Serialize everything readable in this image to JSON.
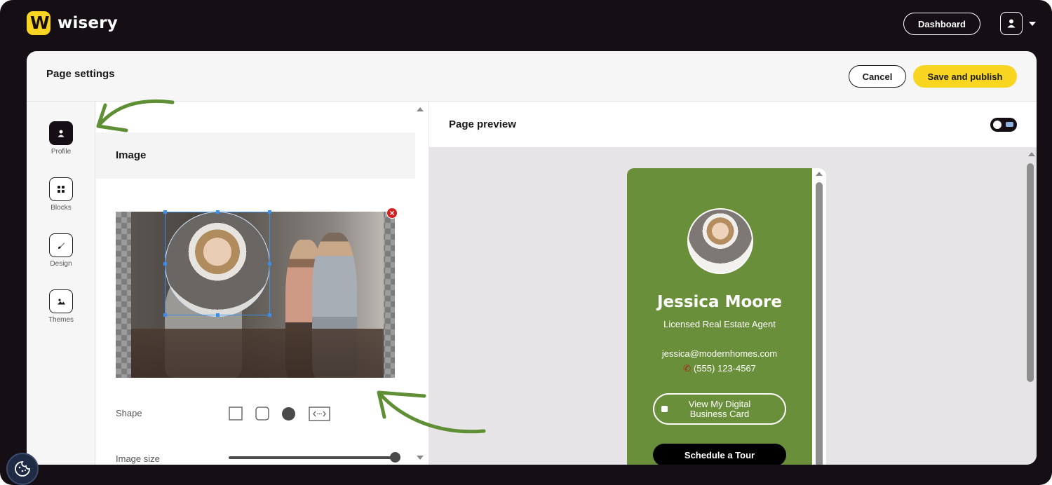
{
  "app": {
    "brand": "wisery",
    "logo_letter": "W"
  },
  "topbar": {
    "dashboard_label": "Dashboard"
  },
  "header": {
    "title": "Page settings",
    "cancel_label": "Cancel",
    "publish_label": "Save and publish"
  },
  "sidebar": {
    "items": [
      {
        "label": "Profile",
        "icon": "person-icon",
        "active": true
      },
      {
        "label": "Blocks",
        "icon": "grid-icon",
        "active": false
      },
      {
        "label": "Design",
        "icon": "brush-icon",
        "active": false
      },
      {
        "label": "Themes",
        "icon": "image-icon",
        "active": false
      }
    ]
  },
  "editor": {
    "section_title": "Image",
    "shape_label": "Shape",
    "shape_options": [
      "square",
      "rounded",
      "circle",
      "custom"
    ],
    "shape_selected": "circle",
    "size_label": "Image size",
    "size_value": 1.0
  },
  "preview": {
    "title": "Page preview",
    "profile": {
      "name": "Jessica Moore",
      "title": "Licensed Real Estate Agent",
      "email": "jessica@modernhomes.com",
      "phone": "(555) 123-4567",
      "button1": "View My Digital Business Card",
      "button2": "Schedule a Tour"
    },
    "accent_color": "#6a8f3a"
  },
  "colors": {
    "brand_yellow": "#f7d520",
    "dark": "#150f15",
    "arrow_green": "#5e8f35"
  }
}
